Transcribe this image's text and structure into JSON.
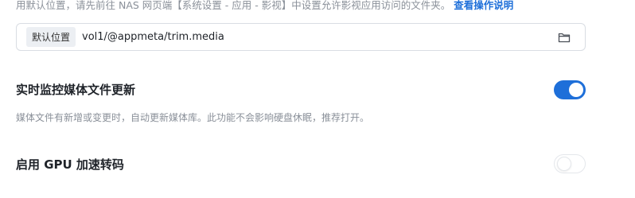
{
  "intro": {
    "text": "用默认位置，请先前往 NAS 网页端【系统设置 - 应用 - 影视】中设置允许影视应用访问的文件夹。",
    "link_label": "查看操作说明"
  },
  "path": {
    "tag": "默认位置",
    "value": "vol1/@appmeta/trim.media"
  },
  "settings": [
    {
      "title": "实时监控媒体文件更新",
      "description": "媒体文件有新增或变更时，自动更新媒体库。此功能不会影响硬盘休眠，推荐打开。",
      "enabled": true
    },
    {
      "title": "启用 GPU 加速转码",
      "enabled": false
    }
  ],
  "colors": {
    "accent": "#1e6fd9",
    "muted_text": "#8a9099"
  },
  "icons": {
    "folder": "folder-icon"
  }
}
